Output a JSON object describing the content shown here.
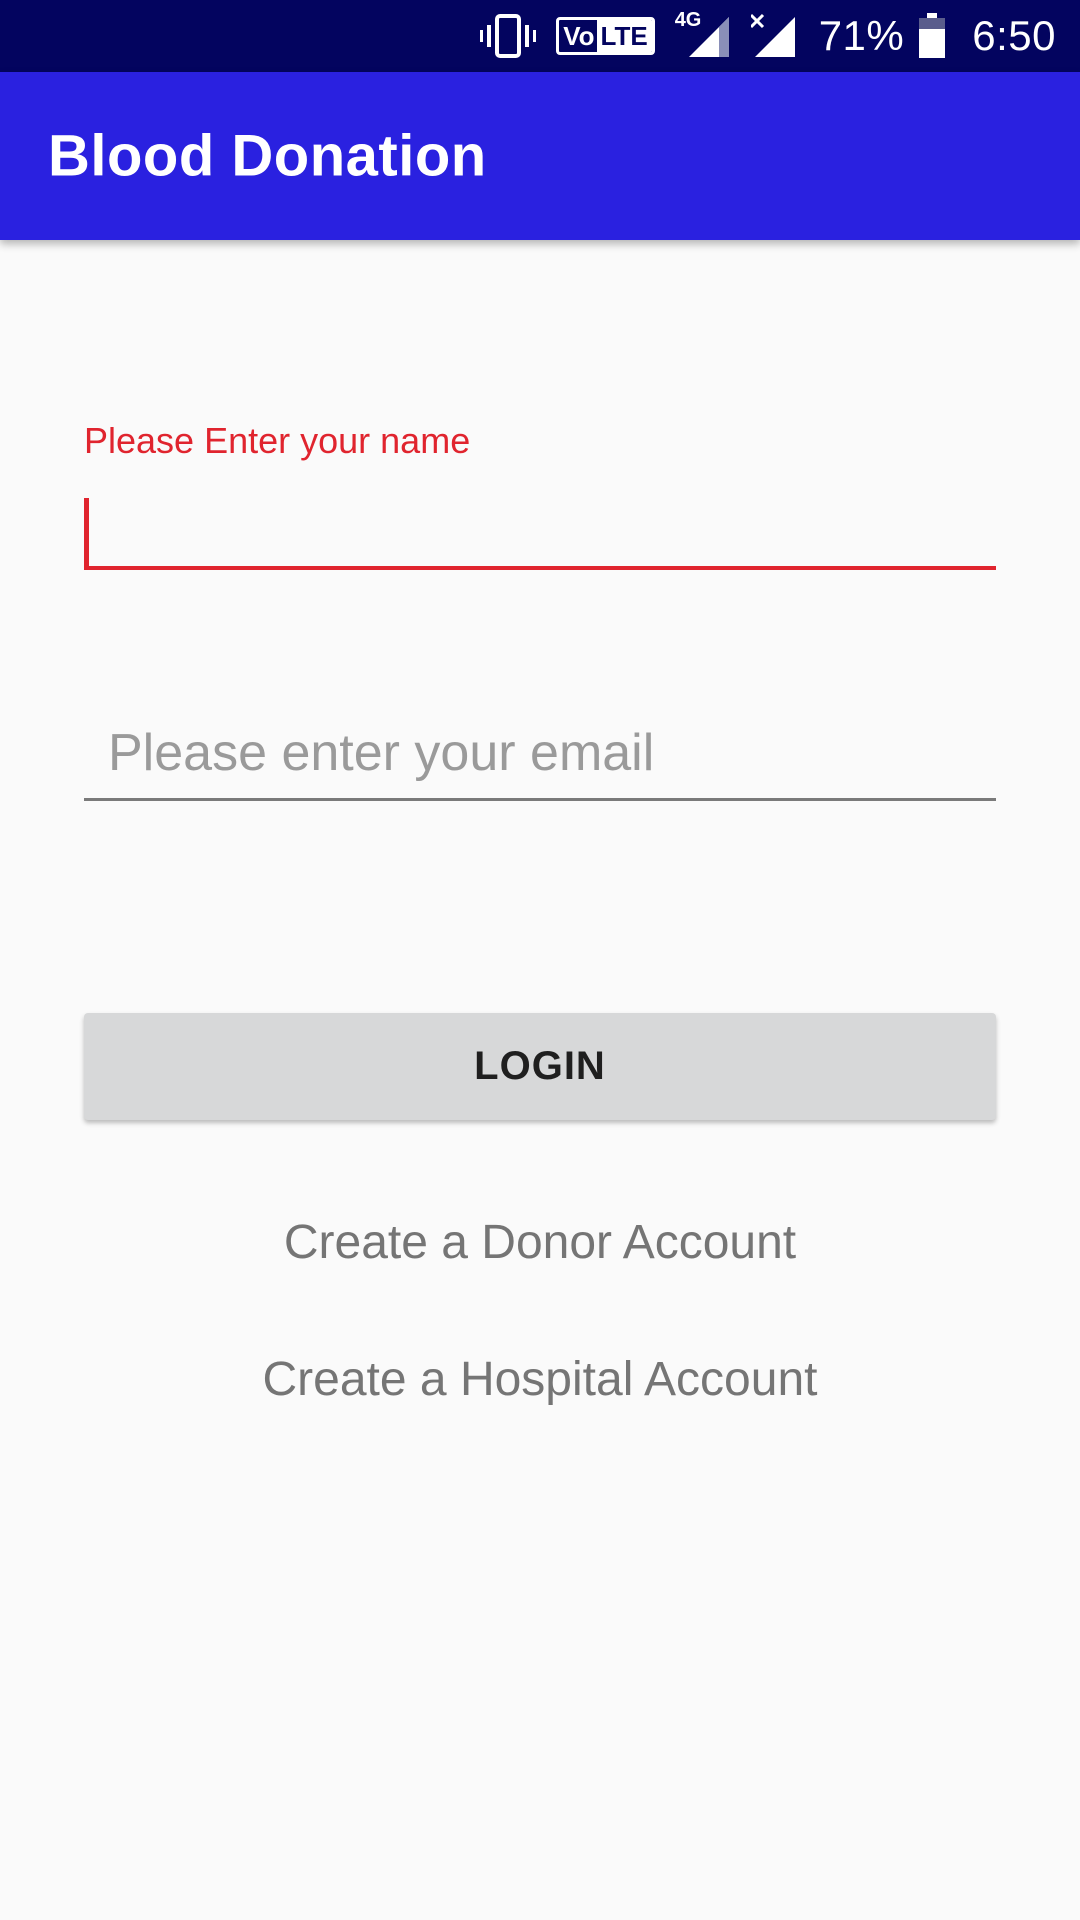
{
  "status_bar": {
    "icons": [
      "vibrate-icon",
      "volte-icon",
      "signal-4g-icon",
      "signal-no-data-icon",
      "battery-icon"
    ],
    "volte_left": "Vo",
    "volte_right": "LTE",
    "network_type": "4G",
    "battery_percent": "71%",
    "time": "6:50",
    "background_color": "#03045f"
  },
  "app_bar": {
    "title": "Blood Donation",
    "background_color": "#2a21e0"
  },
  "form": {
    "name": {
      "label": "Please Enter your name",
      "value": "",
      "accent_color": "#e0242e"
    },
    "email": {
      "placeholder": "Please enter your email",
      "value": ""
    },
    "login_label": "LOGIN"
  },
  "links": {
    "donor": "Create a Donor Account",
    "hospital": "Create a Hospital Account"
  }
}
